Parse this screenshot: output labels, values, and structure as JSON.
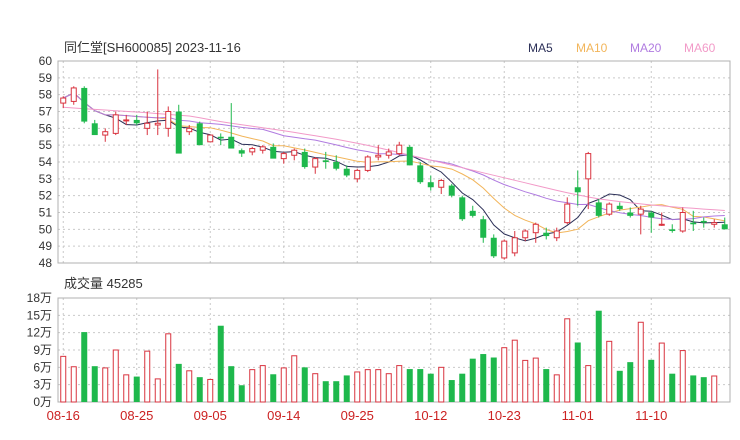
{
  "chart_data": {
    "type": "candlestick",
    "title": "同仁堂[SH600085] 2023-11-16",
    "legend": [
      {
        "name": "MA5",
        "color": "#2b2f57"
      },
      {
        "name": "MA10",
        "color": "#f2b55a"
      },
      {
        "name": "MA20",
        "color": "#b07be0"
      },
      {
        "name": "MA60",
        "color": "#f29ac8"
      }
    ],
    "up_color": "#d9333f",
    "down_color": "#1eb84c",
    "price_axis": {
      "min": 48,
      "max": 60,
      "ticks": [
        "60",
        "59",
        "58",
        "57",
        "56",
        "55",
        "54",
        "53",
        "52",
        "51",
        "50",
        "49",
        "48"
      ]
    },
    "volume_title": "成交量 45285",
    "volume_axis": {
      "max": 18,
      "ticks": [
        "18万",
        "15万",
        "12万",
        "9万",
        "6万",
        "3万",
        "0万"
      ]
    },
    "date_ticks": [
      "08-16",
      "08-25",
      "09-05",
      "09-14",
      "09-25",
      "10-12",
      "10-23",
      "11-01",
      "11-10"
    ],
    "date_tick_index": [
      0,
      7,
      14,
      21,
      28,
      35,
      42,
      49,
      56
    ],
    "candles": [
      [
        57.5,
        57.9,
        57.2,
        57.8
      ],
      [
        57.6,
        58.5,
        57.4,
        58.4
      ],
      [
        58.4,
        58.5,
        56.3,
        56.4
      ],
      [
        56.3,
        56.5,
        55.8,
        55.6
      ],
      [
        55.6,
        56.0,
        55.2,
        55.8
      ],
      [
        55.7,
        57.0,
        55.6,
        56.8
      ],
      [
        56.5,
        56.8,
        56.2,
        56.5
      ],
      [
        56.5,
        56.8,
        56.2,
        56.3
      ],
      [
        56.0,
        57.0,
        55.6,
        56.3
      ],
      [
        56.2,
        59.5,
        55.6,
        56.3
      ],
      [
        56.0,
        57.3,
        55.5,
        57.0
      ],
      [
        57.0,
        57.4,
        55.1,
        54.5
      ],
      [
        55.8,
        56.2,
        55.6,
        56.0
      ],
      [
        56.3,
        56.4,
        55.0,
        55.0
      ],
      [
        55.2,
        55.6,
        55.2,
        55.6
      ],
      [
        55.5,
        55.7,
        55.0,
        55.4
      ],
      [
        55.5,
        57.5,
        55.3,
        54.8
      ],
      [
        54.7,
        54.8,
        54.3,
        54.5
      ],
      [
        54.6,
        54.9,
        54.4,
        54.8
      ],
      [
        54.7,
        55.0,
        54.5,
        54.9
      ],
      [
        54.9,
        55.1,
        54.3,
        54.2
      ],
      [
        54.2,
        54.6,
        53.9,
        54.5
      ],
      [
        54.4,
        54.8,
        54.1,
        54.7
      ],
      [
        54.6,
        54.8,
        53.6,
        53.7
      ],
      [
        53.7,
        54.3,
        53.3,
        54.2
      ],
      [
        54.1,
        54.6,
        53.6,
        54.0
      ],
      [
        54.0,
        54.4,
        53.5,
        53.6
      ],
      [
        53.6,
        53.8,
        53.1,
        53.2
      ],
      [
        53.0,
        53.6,
        52.8,
        53.5
      ],
      [
        53.5,
        54.4,
        53.4,
        54.3
      ],
      [
        54.3,
        55.0,
        54.1,
        54.4
      ],
      [
        54.4,
        54.8,
        54.2,
        54.6
      ],
      [
        54.5,
        55.2,
        54.4,
        55.0
      ],
      [
        54.9,
        55.0,
        53.8,
        53.8
      ],
      [
        53.8,
        54.0,
        52.7,
        52.8
      ],
      [
        52.8,
        53.2,
        52.3,
        52.5
      ],
      [
        52.5,
        53.0,
        52.1,
        52.9
      ],
      [
        52.6,
        52.7,
        51.9,
        52.0
      ],
      [
        51.9,
        52.0,
        50.5,
        50.6
      ],
      [
        51.1,
        51.4,
        50.7,
        50.8
      ],
      [
        50.6,
        50.8,
        49.2,
        49.5
      ],
      [
        49.5,
        49.7,
        48.3,
        48.4
      ],
      [
        48.3,
        49.4,
        48.2,
        49.3
      ],
      [
        48.6,
        49.9,
        48.4,
        49.5
      ],
      [
        49.5,
        50.0,
        49.3,
        49.9
      ],
      [
        49.8,
        50.4,
        49.2,
        50.3
      ],
      [
        49.8,
        50.1,
        49.4,
        49.6
      ],
      [
        49.5,
        50.1,
        49.3,
        49.9
      ],
      [
        50.4,
        51.9,
        50.3,
        51.5
      ],
      [
        52.5,
        53.5,
        51.4,
        52.2
      ],
      [
        53.0,
        54.6,
        51.2,
        54.5
      ],
      [
        51.6,
        51.8,
        50.7,
        50.8
      ],
      [
        50.9,
        51.6,
        50.8,
        51.5
      ],
      [
        51.4,
        51.6,
        51.1,
        51.2
      ],
      [
        51.0,
        51.3,
        50.7,
        50.8
      ],
      [
        50.9,
        51.4,
        49.7,
        51.2
      ],
      [
        51.0,
        51.1,
        49.8,
        50.7
      ],
      [
        50.3,
        51.0,
        50.2,
        50.3
      ],
      [
        50.0,
        50.3,
        49.8,
        49.9
      ],
      [
        49.9,
        51.3,
        49.8,
        51.0
      ],
      [
        50.4,
        51.1,
        49.9,
        50.3
      ],
      [
        50.5,
        50.7,
        50.1,
        50.4
      ],
      [
        50.3,
        50.6,
        50.1,
        50.4
      ],
      [
        50.3,
        50.7,
        50.0,
        50.0
      ]
    ],
    "volumes": [
      7.9,
      6.1,
      12.1,
      6.2,
      5.9,
      9.0,
      4.7,
      4.4,
      8.8,
      4.0,
      11.8,
      6.6,
      5.4,
      4.3,
      3.9,
      13.2,
      6.2,
      2.9,
      5.6,
      6.3,
      4.8,
      5.9,
      8.0,
      6.0,
      4.9,
      3.6,
      3.6,
      4.6,
      5.2,
      5.6,
      5.6,
      4.9,
      6.3,
      5.7,
      5.7,
      4.9,
      6.0,
      3.8,
      4.9,
      7.5,
      8.3,
      7.7,
      9.4,
      10.7,
      7.2,
      7.6,
      5.7,
      4.7,
      14.4,
      10.3,
      6.3,
      15.8,
      10.5,
      5.4,
      6.9,
      13.8,
      7.3,
      10.2,
      4.9,
      8.9,
      4.6,
      4.3,
      4.5
    ]
  }
}
